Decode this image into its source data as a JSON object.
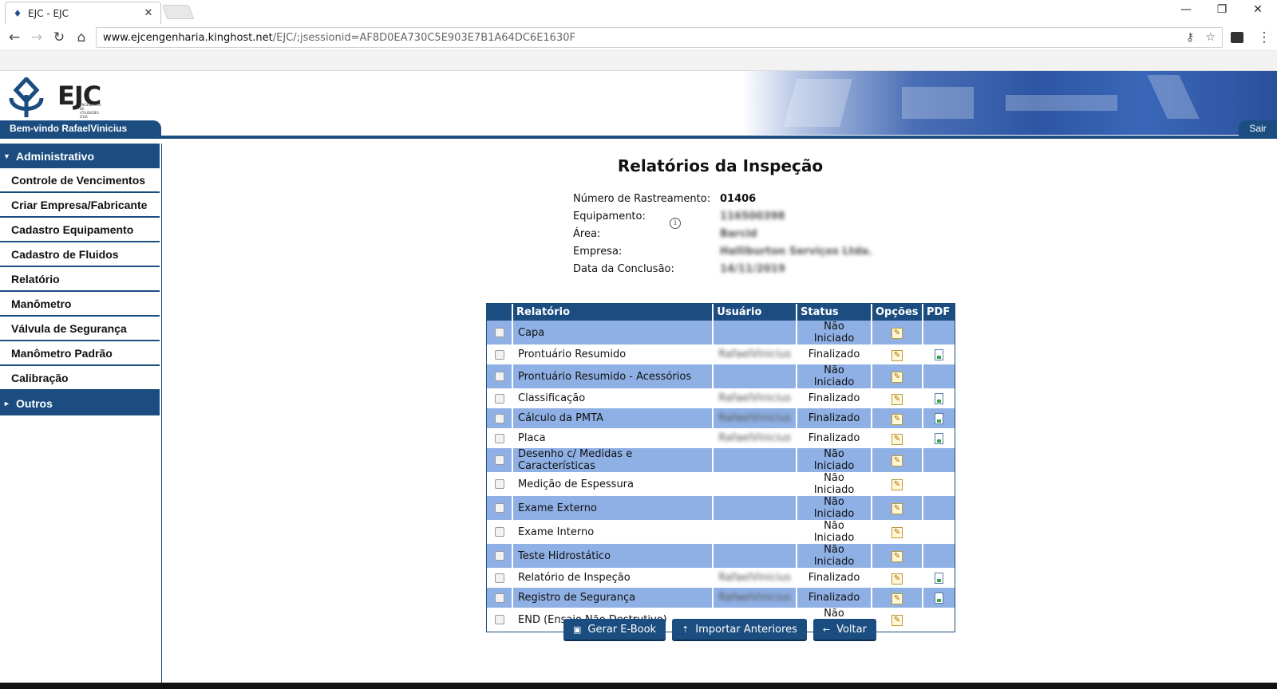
{
  "browser": {
    "tab_title": "EJC - EJC",
    "tab_close": "✕",
    "url_domain": "www.ejcengenharia.kinghost.net",
    "url_path": "/EJC/;jsessionid=AF8D0EA730C5E903E7B1A64DC6E1630F",
    "win_minimize": "—",
    "win_restore": "❐",
    "win_close": "✕",
    "back": "←",
    "forward": "→",
    "reload": "↻",
    "home": "⌂",
    "info_glyph": "i",
    "key_glyph": "⚷",
    "star_glyph": "☆",
    "menu_glyph": "⋮"
  },
  "site": {
    "logo_text": "EJC",
    "logo_sub": "ENGENHARIA DE UTILIDADES LTDA",
    "welcome": "Bem-vindo RafaelVinicius",
    "logout": "Sair"
  },
  "sidebar": {
    "admin_caret": "▼",
    "admin_label": "Administrativo",
    "items": [
      {
        "label": "Controle de Vencimentos"
      },
      {
        "label": "Criar Empresa/Fabricante"
      },
      {
        "label": "Cadastro Equipamento"
      },
      {
        "label": "Cadastro de Fluidos"
      },
      {
        "label": "Relatório"
      },
      {
        "label": "Manômetro"
      },
      {
        "label": "Válvula de Segurança"
      },
      {
        "label": "Manômetro Padrão"
      },
      {
        "label": "Calibração"
      }
    ],
    "others_caret": "►",
    "others_label": "Outros"
  },
  "page": {
    "title": "Relatórios da Inspeção",
    "fields": [
      {
        "label": "Número de Rastreamento:",
        "value": "01406"
      },
      {
        "label": "Equipamento:",
        "value": "116500398"
      },
      {
        "label": "Área:",
        "value": "Barcid"
      },
      {
        "label": "Empresa:",
        "value": "Halliburton Serviços Ltda."
      },
      {
        "label": "Data da Conclusão:",
        "value": "14/11/2019"
      }
    ]
  },
  "table": {
    "headers": {
      "relatorio": "Relatório",
      "usuario": "Usuário",
      "status": "Status",
      "opcoes": "Opções",
      "pdf": "PDF"
    },
    "edit_glyph": "✎",
    "rows": [
      {
        "name": "Capa",
        "user": "",
        "status": "Não Iniciado",
        "pdf": false
      },
      {
        "name": "Prontuário Resumido",
        "user": "RafaelVinicius",
        "status": "Finalizado",
        "pdf": true
      },
      {
        "name": "Prontuário Resumido - Acessórios",
        "user": "",
        "status": "Não Iniciado",
        "pdf": false
      },
      {
        "name": "Classificação",
        "user": "RafaelVinicius",
        "status": "Finalizado",
        "pdf": true
      },
      {
        "name": "Cálculo da PMTA",
        "user": "RafaelVinicius",
        "status": "Finalizado",
        "pdf": true
      },
      {
        "name": "Placa",
        "user": "RafaelVinicius",
        "status": "Finalizado",
        "pdf": true
      },
      {
        "name": "Desenho c/ Medidas e Características",
        "user": "",
        "status": "Não Iniciado",
        "pdf": false
      },
      {
        "name": "Medição de Espessura",
        "user": "",
        "status": "Não Iniciado",
        "pdf": false
      },
      {
        "name": "Exame Externo",
        "user": "",
        "status": "Não Iniciado",
        "pdf": false
      },
      {
        "name": "Exame Interno",
        "user": "",
        "status": "Não Iniciado",
        "pdf": false
      },
      {
        "name": "Teste Hidrostático",
        "user": "",
        "status": "Não Iniciado",
        "pdf": false
      },
      {
        "name": "Relatório de Inspeção",
        "user": "RafaelVinicius",
        "status": "Finalizado",
        "pdf": true
      },
      {
        "name": "Registro de Segurança",
        "user": "RafaelVinicius",
        "status": "Finalizado",
        "pdf": true
      },
      {
        "name": "END (Ensaio Não Destrutivo)",
        "user": "",
        "status": "Não Iniciado",
        "pdf": false
      }
    ]
  },
  "actions": {
    "ebook_icon": "▣",
    "ebook": "Gerar E-Book",
    "import_icon": "⇡",
    "import": "Importar Anteriores",
    "back_icon": "←",
    "back": "Voltar"
  },
  "colors": {
    "primary": "#1b4d80",
    "row_alt": "#8fb0e4"
  }
}
